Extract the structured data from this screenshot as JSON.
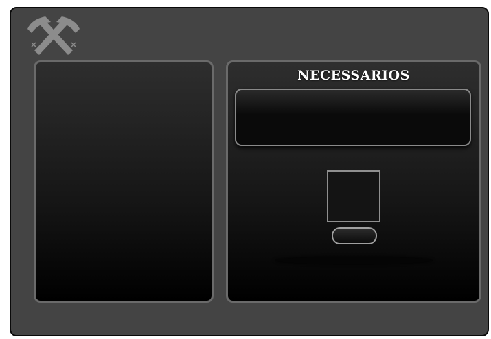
{
  "header": {
    "logo_icon": "crossed-hammers-icon"
  },
  "crafting_panel": {
    "title": "NECESSARIOS",
    "slot_icon": "empty-item-slot",
    "craft_button_label": ""
  },
  "colors": {
    "window_background": "#444444",
    "window_border": "#0a0a0a",
    "panel_border": "#6a6a6a",
    "title_text": "#ffffff"
  }
}
